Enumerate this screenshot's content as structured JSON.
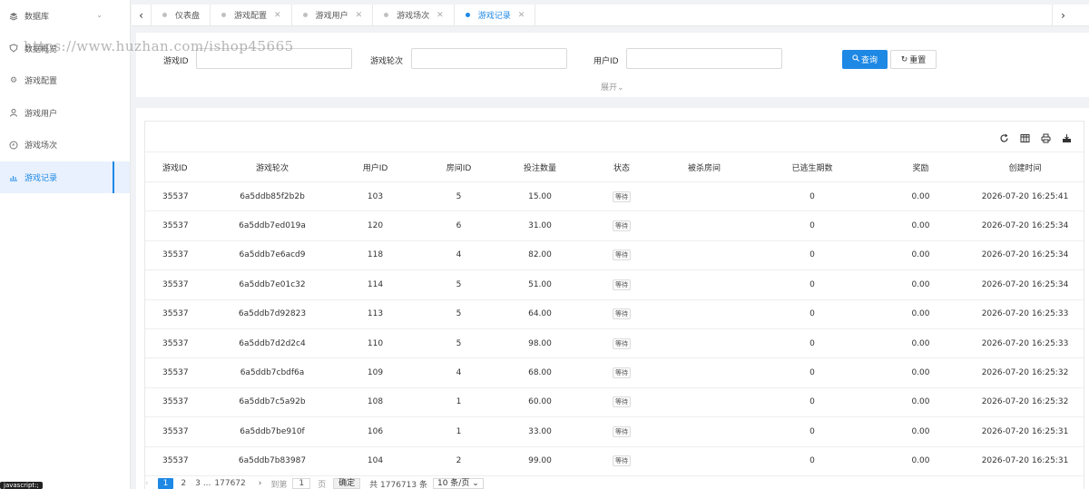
{
  "watermark": "https://www.huzhan.com/ishop45665",
  "sidebar": {
    "items": [
      {
        "label": "数据库",
        "icon": "layers-icon"
      },
      {
        "label": "数据概览",
        "icon": "shield-icon"
      },
      {
        "label": "游戏配置",
        "icon": "gear-icon"
      },
      {
        "label": "游戏用户",
        "icon": "user-icon"
      },
      {
        "label": "游戏场次",
        "icon": "clock-icon"
      },
      {
        "label": "游戏记录",
        "icon": "chart-icon"
      }
    ]
  },
  "tabs": [
    {
      "label": "仪表盘"
    },
    {
      "label": "游戏配置"
    },
    {
      "label": "游戏用户"
    },
    {
      "label": "游戏场次"
    },
    {
      "label": "游戏记录"
    }
  ],
  "search": {
    "game_id_label": "游戏ID",
    "round_label": "游戏轮次",
    "user_id_label": "用户ID",
    "query_button": "查询",
    "reset_button": "重置",
    "expand": "展开"
  },
  "table": {
    "headers": [
      "游戏ID",
      "游戏轮次",
      "用户ID",
      "房间ID",
      "投注数量",
      "状态",
      "被杀房间",
      "已逃生期数",
      "奖励",
      "创建时间"
    ],
    "rows": [
      [
        "35537",
        "6a5ddb85f2b2b",
        "103",
        "5",
        "15.00",
        "等待",
        "",
        "0",
        "0.00",
        "2026-07-20 16:25:41"
      ],
      [
        "35537",
        "6a5ddb7ed019a",
        "120",
        "6",
        "31.00",
        "等待",
        "",
        "0",
        "0.00",
        "2026-07-20 16:25:34"
      ],
      [
        "35537",
        "6a5ddb7e6acd9",
        "118",
        "4",
        "82.00",
        "等待",
        "",
        "0",
        "0.00",
        "2026-07-20 16:25:34"
      ],
      [
        "35537",
        "6a5ddb7e01c32",
        "114",
        "5",
        "51.00",
        "等待",
        "",
        "0",
        "0.00",
        "2026-07-20 16:25:34"
      ],
      [
        "35537",
        "6a5ddb7d92823",
        "113",
        "5",
        "64.00",
        "等待",
        "",
        "0",
        "0.00",
        "2026-07-20 16:25:33"
      ],
      [
        "35537",
        "6a5ddb7d2d2c4",
        "110",
        "5",
        "98.00",
        "等待",
        "",
        "0",
        "0.00",
        "2026-07-20 16:25:33"
      ],
      [
        "35537",
        "6a5ddb7cbdf6a",
        "109",
        "4",
        "68.00",
        "等待",
        "",
        "0",
        "0.00",
        "2026-07-20 16:25:32"
      ],
      [
        "35537",
        "6a5ddb7c5a92b",
        "108",
        "1",
        "60.00",
        "等待",
        "",
        "0",
        "0.00",
        "2026-07-20 16:25:32"
      ],
      [
        "35537",
        "6a5ddb7be910f",
        "106",
        "1",
        "33.00",
        "等待",
        "",
        "0",
        "0.00",
        "2026-07-20 16:25:31"
      ],
      [
        "35537",
        "6a5ddb7b83987",
        "104",
        "2",
        "99.00",
        "等待",
        "",
        "0",
        "0.00",
        "2026-07-20 16:25:31"
      ]
    ]
  },
  "pager": {
    "current": "1",
    "pages": [
      "2",
      "3"
    ],
    "ellipsis": "...",
    "last": "177672",
    "goto_label": "到第",
    "goto_value": "1",
    "page_unit": "页",
    "confirm": "确定",
    "total": "共 1776713 条",
    "page_size": "10 条/页"
  },
  "status_bar": "javascript:;",
  "colors": {
    "accent": "#1e88e5"
  }
}
